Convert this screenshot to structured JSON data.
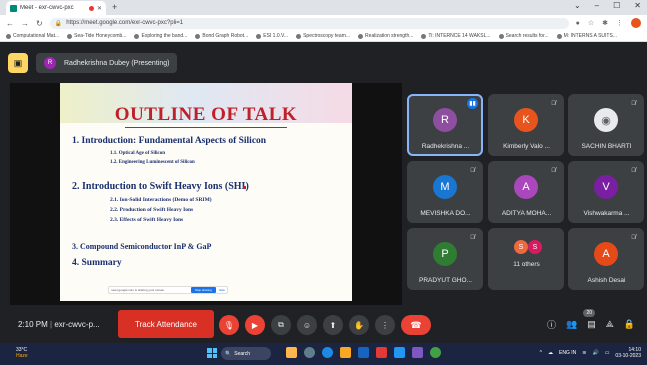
{
  "browser": {
    "tab_title": "Meet - exr-cwvc-pxc",
    "url": "https://meet.google.com/exr-cwvc-pxc?pli=1",
    "bookmarks": [
      "Computational Mat...",
      "Sea-Tide Honeycomb...",
      "Exploring the band...",
      "Bond Graph Robot...",
      "ESI 1.0.V...",
      "Spectroscopy team...",
      "Realization strength...",
      "Ti: INTERNCE 14 WAKSL...",
      "Search results for...",
      "M: INTERNS A SUITS..."
    ]
  },
  "meet": {
    "presenter_label": "Radhekrishna Dubey (Presenting)",
    "presenter_initial": "R",
    "slide": {
      "title": "OUTLINE OF TALK",
      "s1": "1.  Introduction: Fundamental Aspects of Silicon",
      "s1a": "1.1. Optical Age of  Silicon",
      "s1b": "1.2. Engineering Luminescent of  Silicon",
      "s2": "2.  Introduction  to Swift Heavy Ions (SHI)",
      "s2a": "2.1.  Ion-Solid Interactions (Demo of SRIM)",
      "s2b": "2.2.  Production of Swift Heavy Ions",
      "s2c": "2.3.  Effects  of Swift Heavy Ions",
      "s3": "3.  Compound Semiconductor InP & GaP",
      "s4": "4.  Summary",
      "share_notice": "meet.google.com is sharing your screen.",
      "stop_label": "Stop sharing",
      "hide_label": "Hide"
    },
    "participants": [
      {
        "name": "Radhekrishna ...",
        "initial": "R",
        "color": "#8e4fa0"
      },
      {
        "name": "Kimberly Valo ...",
        "initial": "K",
        "color": "#e8541e"
      },
      {
        "name": "SACHIN BHARTI",
        "initial": "",
        "color": "#e8eaed"
      },
      {
        "name": "MEVISHKA DO...",
        "initial": "M",
        "color": "#1976d2"
      },
      {
        "name": "ADITYA MOHA...",
        "initial": "A",
        "color": "#ab47bc"
      },
      {
        "name": "Vishwakarma ...",
        "initial": "V",
        "color": "#7b1fa2"
      },
      {
        "name": "PRADYUT GHO...",
        "initial": "P",
        "color": "#2e7d32"
      },
      {
        "name": "11 others",
        "initial": "S",
        "color": "#ec6a3e"
      },
      {
        "name": "Ashish Desai",
        "initial": "A",
        "color": "#e64a19"
      }
    ],
    "clock": "2:10 PM",
    "meeting_code": "exr-cwvc-p...",
    "track_label": "Track Attendance",
    "people_count": "20"
  },
  "taskbar": {
    "weather_temp": "33°C",
    "weather_desc": "Haze",
    "search_label": "Search",
    "lang": "ENG IN",
    "time": "14:10",
    "date": "03-10-2023"
  }
}
